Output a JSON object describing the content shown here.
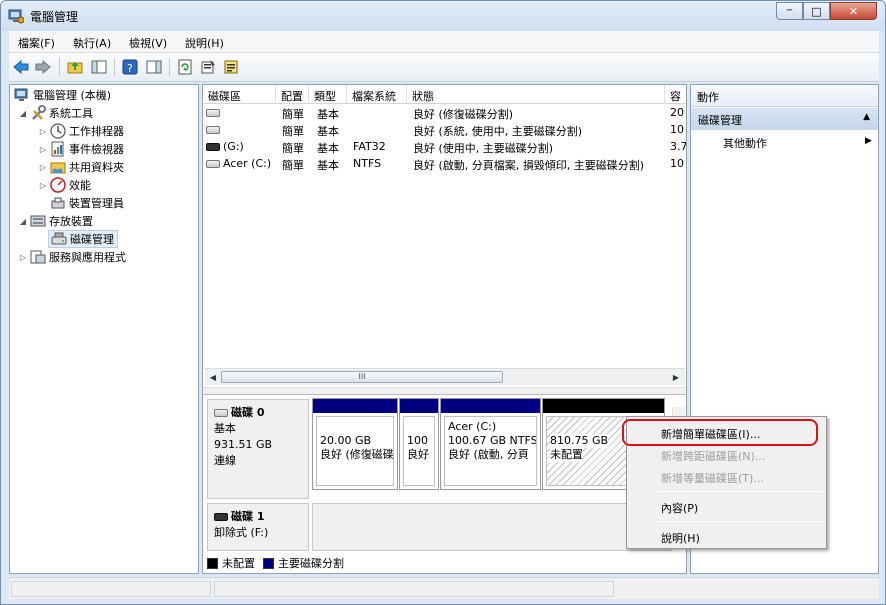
{
  "window": {
    "title": "電腦管理",
    "minimize_label": "─",
    "maximize_label": "□",
    "close_label": "✕"
  },
  "menu": [
    "檔案(F)",
    "執行(A)",
    "檢視(V)",
    "說明(H)"
  ],
  "tree": {
    "root": "電腦管理 (本機)",
    "system_tools": "系統工具",
    "task_scheduler": "工作排程器",
    "event_viewer": "事件檢視器",
    "shared_folders": "共用資料夾",
    "performance": "效能",
    "device_manager": "裝置管理員",
    "storage": "存放裝置",
    "disk_management": "磁碟管理",
    "services_apps": "服務與應用程式"
  },
  "volume_list": {
    "columns": [
      "磁碟區",
      "配置",
      "類型",
      "檔案系統",
      "狀態",
      "容"
    ],
    "rows": [
      {
        "volume": "",
        "layout": "簡單",
        "type": "基本",
        "fs": "",
        "status": "良好 (修復磁碟分割)",
        "cap": "20"
      },
      {
        "volume": "",
        "layout": "簡單",
        "type": "基本",
        "fs": "",
        "status": "良好 (系統, 使用中, 主要磁碟分割)",
        "cap": "10"
      },
      {
        "volume": "(G:)",
        "layout": "簡單",
        "type": "基本",
        "fs": "FAT32",
        "status": "良好 (使用中, 主要磁碟分割)",
        "cap": "3.7"
      },
      {
        "volume": "Acer (C:)",
        "layout": "簡單",
        "type": "基本",
        "fs": "NTFS",
        "status": "良好 (啟動, 分頁檔案, 損毀傾印, 主要磁碟分割)",
        "cap": "10"
      }
    ],
    "scroll_thumb_label": "III"
  },
  "disks": [
    {
      "name": "磁碟 0",
      "kind": "基本",
      "size": "931.51 GB",
      "status": "連線",
      "partitions": [
        {
          "line1": "",
          "line2": "20.00 GB",
          "line3": "良好 (修復磁碟",
          "bar_color": "#000080"
        },
        {
          "line1": "",
          "line2": "100",
          "line3": "良好",
          "bar_color": "#000080"
        },
        {
          "line1": "Acer  (C:)",
          "line2": "100.67 GB NTFS",
          "line3": "良好 (啟動, 分頁",
          "bar_color": "#000080"
        },
        {
          "line1": "",
          "line2": "810.75 GB",
          "line3": "未配置",
          "bar_color": "#000000"
        }
      ]
    },
    {
      "name": "磁碟 1",
      "kind": "卸除式 (F:)"
    }
  ],
  "legend": [
    {
      "label": "未配置",
      "color": "#000000"
    },
    {
      "label": "主要磁碟分割",
      "color": "#000080"
    }
  ],
  "actions": {
    "header": "動作",
    "section": "磁碟管理",
    "more": "其他動作"
  },
  "context_menu": {
    "new_simple": "新增簡單磁碟區(I)...",
    "new_spanned": "新增跨距磁碟區(N)...",
    "new_striped": "新增等量磁碟區(T)...",
    "properties": "內容(P)",
    "help": "說明(H)"
  },
  "colors": {
    "primary_partition": "#000080",
    "unallocated": "#000000",
    "highlight_ring": "#d8121b"
  }
}
